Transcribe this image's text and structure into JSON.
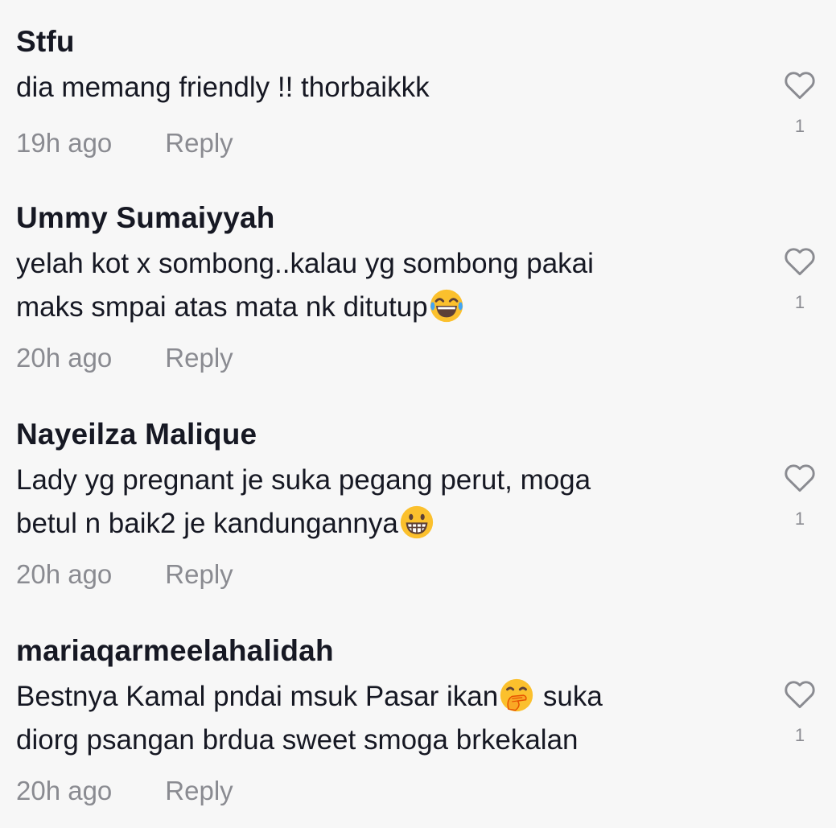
{
  "comments": [
    {
      "username": "Stfu",
      "text_lines": [
        "dia memang friendly !! thorbaikkk"
      ],
      "time": "19h ago",
      "reply_label": "Reply",
      "likes": "1"
    },
    {
      "username": "Ummy Sumaiyyah",
      "text_lines": [
        "yelah kot x sombong..kalau yg sombong pakai",
        "maks smpai atas mata nk ditutup"
      ],
      "emoji": "tears-of-joy-emoji",
      "time": "20h ago",
      "reply_label": "Reply",
      "likes": "1"
    },
    {
      "username": "Nayeilza Malique",
      "text_lines": [
        "Lady yg pregnant je suka pegang perut, moga",
        "betul n baik2 je kandungannya"
      ],
      "emoji": "grinning-face-emoji",
      "time": "20h ago",
      "reply_label": "Reply",
      "likes": "1"
    },
    {
      "username": "mariaqarmeelahalidah",
      "text_lines": [
        "Bestnya Kamal pndai msuk Pasar ikan",
        " suka",
        "diorg psangan brdua sweet smoga brkekalan"
      ],
      "emoji": "hand-over-mouth-emoji",
      "time": "20h ago",
      "reply_label": "Reply",
      "likes": "1"
    }
  ],
  "icons": {
    "like": "heart-outline-icon"
  },
  "colors": {
    "background": "#f7f7f7",
    "primary_text": "#161823",
    "secondary_text": "#8a8b91"
  }
}
